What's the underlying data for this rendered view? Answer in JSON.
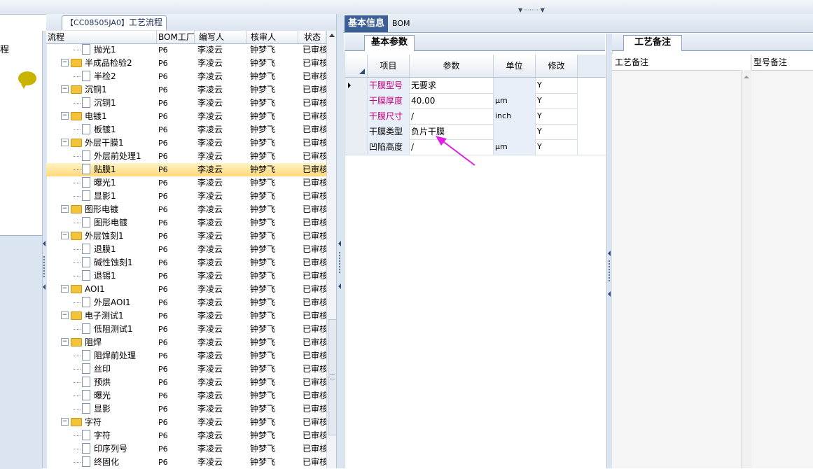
{
  "left_panel": {
    "label": "程"
  },
  "tree_panel": {
    "tab_title_code": "【CC08505JA0】",
    "tab_title": "工艺流程",
    "columns": [
      "流程",
      "BOM工厂",
      "编写人",
      "核审人",
      "状态"
    ],
    "rows": [
      {
        "name": "抛光1",
        "type": "doc",
        "bom": "P6",
        "writer": "李凌云",
        "reviewer": "钟梦飞",
        "status": "已审核"
      },
      {
        "name": "半成品检验2",
        "type": "folder",
        "bom": "P6",
        "writer": "李凌云",
        "reviewer": "钟梦飞",
        "status": "已审核"
      },
      {
        "name": "半检2",
        "type": "doc",
        "bom": "P6",
        "writer": "李凌云",
        "reviewer": "钟梦飞",
        "status": "已审核"
      },
      {
        "name": "沉铜1",
        "type": "folder",
        "bom": "P6",
        "writer": "李凌云",
        "reviewer": "钟梦飞",
        "status": "已审核"
      },
      {
        "name": "沉铜1",
        "type": "doc",
        "bom": "P6",
        "writer": "李凌云",
        "reviewer": "钟梦飞",
        "status": "已审核"
      },
      {
        "name": "电镀1",
        "type": "folder",
        "bom": "P6",
        "writer": "李凌云",
        "reviewer": "钟梦飞",
        "status": "已审核"
      },
      {
        "name": "板镀1",
        "type": "doc",
        "bom": "P6",
        "writer": "李凌云",
        "reviewer": "钟梦飞",
        "status": "已审核"
      },
      {
        "name": "外层干膜1",
        "type": "folder",
        "bom": "P6",
        "writer": "李凌云",
        "reviewer": "钟梦飞",
        "status": "已审核"
      },
      {
        "name": "外层前处理1",
        "type": "doc",
        "bom": "P6",
        "writer": "李凌云",
        "reviewer": "钟梦飞",
        "status": "已审核"
      },
      {
        "name": "贴膜1",
        "type": "doc",
        "bom": "P6",
        "writer": "李凌云",
        "reviewer": "钟梦飞",
        "status": "已审核",
        "selected": true
      },
      {
        "name": "曝光1",
        "type": "doc",
        "bom": "P6",
        "writer": "李凌云",
        "reviewer": "钟梦飞",
        "status": "已审核"
      },
      {
        "name": "显影1",
        "type": "doc",
        "bom": "P6",
        "writer": "李凌云",
        "reviewer": "钟梦飞",
        "status": "已审核"
      },
      {
        "name": "图形电镀",
        "type": "folder",
        "bom": "P6",
        "writer": "李凌云",
        "reviewer": "钟梦飞",
        "status": "已审核"
      },
      {
        "name": "图形电镀",
        "type": "doc",
        "bom": "P6",
        "writer": "李凌云",
        "reviewer": "钟梦飞",
        "status": "已审核"
      },
      {
        "name": "外层蚀刻1",
        "type": "folder",
        "bom": "P6",
        "writer": "李凌云",
        "reviewer": "钟梦飞",
        "status": "已审核"
      },
      {
        "name": "退膜1",
        "type": "doc",
        "bom": "P6",
        "writer": "李凌云",
        "reviewer": "钟梦飞",
        "status": "已审核"
      },
      {
        "name": "碱性蚀刻1",
        "type": "doc",
        "bom": "P6",
        "writer": "李凌云",
        "reviewer": "钟梦飞",
        "status": "已审核"
      },
      {
        "name": "退锡1",
        "type": "doc",
        "bom": "P6",
        "writer": "李凌云",
        "reviewer": "钟梦飞",
        "status": "已审核"
      },
      {
        "name": "AOI1",
        "type": "folder",
        "bom": "P6",
        "writer": "李凌云",
        "reviewer": "钟梦飞",
        "status": "已审核"
      },
      {
        "name": "外层AOI1",
        "type": "doc",
        "bom": "P6",
        "writer": "李凌云",
        "reviewer": "钟梦飞",
        "status": "已审核"
      },
      {
        "name": "电子测试1",
        "type": "folder",
        "bom": "P6",
        "writer": "李凌云",
        "reviewer": "钟梦飞",
        "status": "已审核"
      },
      {
        "name": "低阻测试1",
        "type": "doc",
        "bom": "P6",
        "writer": "李凌云",
        "reviewer": "钟梦飞",
        "status": "已审核"
      },
      {
        "name": "阻焊",
        "type": "folder",
        "bom": "P6",
        "writer": "李凌云",
        "reviewer": "钟梦飞",
        "status": "已审核"
      },
      {
        "name": "阻焊前处理",
        "type": "doc",
        "bom": "P6",
        "writer": "李凌云",
        "reviewer": "钟梦飞",
        "status": "已审核"
      },
      {
        "name": "丝印",
        "type": "doc",
        "bom": "P6",
        "writer": "李凌云",
        "reviewer": "钟梦飞",
        "status": "已审核"
      },
      {
        "name": "预烘",
        "type": "doc",
        "bom": "P6",
        "writer": "李凌云",
        "reviewer": "钟梦飞",
        "status": "已审核"
      },
      {
        "name": "曝光",
        "type": "doc",
        "bom": "P6",
        "writer": "李凌云",
        "reviewer": "钟梦飞",
        "status": "已审核"
      },
      {
        "name": "显影",
        "type": "doc",
        "bom": "P6",
        "writer": "李凌云",
        "reviewer": "钟梦飞",
        "status": "已审核"
      },
      {
        "name": "字符",
        "type": "folder",
        "bom": "P6",
        "writer": "李凌云",
        "reviewer": "钟梦飞",
        "status": "已审核"
      },
      {
        "name": "字符",
        "type": "doc",
        "bom": "P6",
        "writer": "李凌云",
        "reviewer": "钟梦飞",
        "status": "已审核"
      },
      {
        "name": "印序列号",
        "type": "doc",
        "bom": "P6",
        "writer": "李凌云",
        "reviewer": "钟梦飞",
        "status": "已审核"
      },
      {
        "name": "终固化",
        "type": "doc",
        "bom": "P6",
        "writer": "李凌云",
        "reviewer": "钟梦飞",
        "status": "已审核"
      }
    ]
  },
  "right_tabs": {
    "basic_info": "基本信息",
    "bom": "BOM"
  },
  "params_panel": {
    "tab_title": "基本参数",
    "columns": {
      "item": "项目",
      "param": "参数",
      "unit": "单位",
      "modify": "修改"
    },
    "rows": [
      {
        "item": "干膜型号",
        "param": "无要求",
        "unit": "",
        "modify": "Y",
        "item_color": "#c0007a",
        "current": true
      },
      {
        "item": "干膜厚度",
        "param": "40.00",
        "unit": "μm",
        "modify": "Y",
        "item_color": "#c0007a"
      },
      {
        "item": "干膜尺寸",
        "param": "/",
        "unit": "inch",
        "modify": "Y",
        "item_color": "#c0007a"
      },
      {
        "item": "干膜类型",
        "param": "负片干膜",
        "unit": "",
        "modify": "Y",
        "item_color": "#000000"
      },
      {
        "item": "凹陷高度",
        "param": "/",
        "unit": "μm",
        "modify": "Y",
        "item_color": "#000000"
      }
    ]
  },
  "notes_panel": {
    "tab_title": "工艺备注",
    "columns": {
      "process_note": "工艺备注",
      "model_note": "型号备注"
    }
  },
  "colors": {
    "selected_row": "#ffd978",
    "accent_tab": "#3c5f95",
    "annotation_arrow": "#e020e0"
  }
}
